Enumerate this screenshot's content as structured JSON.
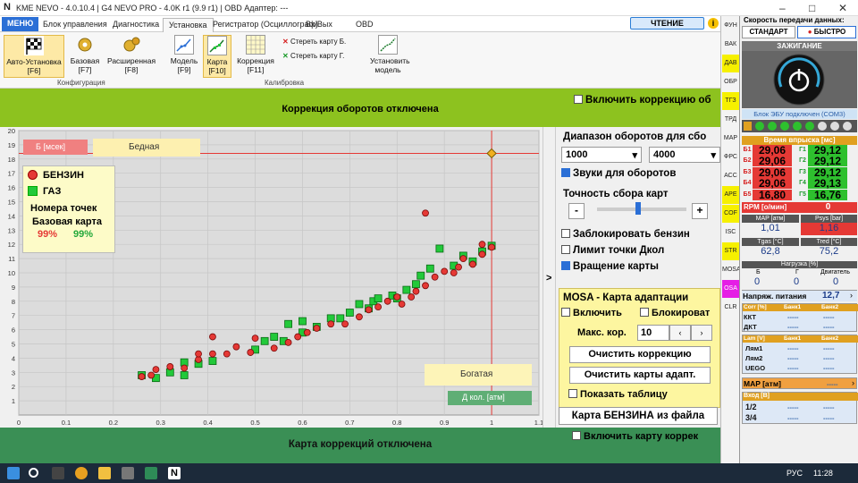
{
  "titlebar": {
    "title": "KME NEVO - 4.0.10.4  |  G4 NEVO PRO - 4.0K r1 (9.9 r1)  |  OBD Адаптер: ---"
  },
  "menu": {
    "items": [
      "МЕНЮ",
      "Блок управления",
      "Диагностика",
      "Установка",
      "Регистратор (Осциллограф)",
      "Вх/Вых",
      "OBD"
    ],
    "read_button": "ЧТЕНИЕ"
  },
  "ribbon": {
    "auto": "Авто-Установка [F6]",
    "base": "Базовая [F7]",
    "ext": "Расширенная [F8]",
    "model": "Модель [F9]",
    "map": "Карта [F10]",
    "corr": "Коррекция [F11]",
    "erase_b": "Стереть карту Б.",
    "erase_g": "Стереть карту Г.",
    "set_model": "Установить модель",
    "group_config": "Конфигурация",
    "group_calib": "Калибровка"
  },
  "banner_top": {
    "text": "Коррекция оборотов отключена",
    "checkbox": "Включить коррекцию об"
  },
  "banner_bottom": {
    "text": "Карта коррекций отключена",
    "checkbox": "Включить карту коррек"
  },
  "chart_labels": {
    "b_label": "Б [мсек]",
    "poor": "Бедная",
    "rich": "Богатая",
    "d_label": "Д кол. [атм]"
  },
  "legend": {
    "petrol": "БЕНЗИН",
    "gas": "ГАЗ",
    "points_title": "Номера точек",
    "base_title": "Базовая карта",
    "petrol_pct": "99%",
    "gas_pct": "99%"
  },
  "right_panel": {
    "rpm_range": "Диапазон оборотов для сбо",
    "rpm_from": "1000",
    "rpm_to": "4000",
    "sounds": "Звуки для оборотов",
    "precision": "Точность сбора карт",
    "minus": "-",
    "plus": "+",
    "block_petrol": "Заблокировать бензин",
    "limit": "Лимит точки Дкол",
    "rotate": "Вращение карты",
    "mosa_title": "MOSA - Карта адаптации",
    "enable": "Включить",
    "block": "Блокироват",
    "max_corr_label": "Макс. кор.",
    "max_corr": "10",
    "clear_corr": "Очистить коррекцию",
    "clear_maps": "Очистить карты адапт.",
    "show_table": "Показать таблицу",
    "load_map": "Карта БЕНЗИНА из файла"
  },
  "sidenav": [
    "ФУН",
    "ВАК",
    "ДАВ",
    "ОБР",
    "ТГЗ",
    "ТРД",
    "МАР",
    "ФРС",
    "АСС",
    "АРЕ",
    "COF",
    "ISC",
    "STR",
    "MOSA",
    "OSA",
    "CLR"
  ],
  "dash": {
    "speed_title": "Скорость передачи данных:",
    "std": "СТАНДАРТ",
    "fast": "БЫСТРО",
    "ignition": "ЗАЖИГАНИЕ",
    "ecu": "Блок ЭБУ подключен (COM3)",
    "inj_title": "Время впрыска [мс]",
    "b_labels": [
      "Б1",
      "Б2",
      "Б3",
      "Б4",
      "Б5"
    ],
    "b_vals": [
      "29,06",
      "29,06",
      "29,06",
      "29,06",
      "16,80"
    ],
    "g_labels": [
      "Г1",
      "Г2",
      "Г3",
      "Г4",
      "Г5"
    ],
    "g_vals": [
      "29,12",
      "29,12",
      "29,12",
      "29,13",
      "16,76"
    ],
    "rpm_label": "RPM [о/мин]",
    "rpm": "0",
    "map_label": "MAP [атм]",
    "map": "1,01",
    "psys_label": "Psys [bar]",
    "psys": "1,16",
    "tgas_label": "Tgas [°C]",
    "tgas": "62,8",
    "tred_label": "Tred [°C]",
    "tred": "75,2",
    "load_label": "Нагрузка [%]",
    "b": "Б",
    "g": "Г",
    "engine": "Двигатель",
    "b_load": "0",
    "g_load": "0",
    "e_load": "0",
    "voltage_label": "Напряж. питания",
    "voltage": "12,7",
    "corr_label": "Corr [%]",
    "bank1": "Банк1",
    "bank2": "Банк2",
    "kkt": "ККТ",
    "dkt": "ДКТ",
    "lam_label": "Lam [V]",
    "lam1": "Лям1",
    "lam2": "Лям2",
    "uego": "UEGO",
    "map2_label": "MAP  [атм]",
    "in_label": "Вход [В]",
    "in1": "1/2",
    "in2": "3/4",
    "dash": "-----"
  },
  "taskbar": {
    "lang": "РУС",
    "time": "11:28"
  },
  "chart_data": {
    "type": "scatter",
    "xlabel": "Д кол. [атм]",
    "ylabel": "Б [мсек]",
    "xlim": [
      0,
      1.1
    ],
    "ylim": [
      0,
      20
    ],
    "x_ticks": [
      0,
      0.1,
      0.2,
      0.3,
      0.4,
      0.5,
      0.6,
      0.7,
      0.8,
      0.9,
      1,
      1.1
    ],
    "y_ticks": [
      1,
      2,
      3,
      4,
      5,
      6,
      7,
      8,
      9,
      10,
      11,
      12,
      13,
      14,
      15,
      16,
      17,
      18,
      19,
      20
    ],
    "series": [
      {
        "name": "БЕНЗИН",
        "color": "#e53935",
        "points": [
          [
            0.26,
            2.7
          ],
          [
            0.28,
            2.8
          ],
          [
            0.29,
            3.2
          ],
          [
            0.32,
            3.4
          ],
          [
            0.35,
            3.3
          ],
          [
            0.38,
            3.9
          ],
          [
            0.38,
            4.3
          ],
          [
            0.41,
            4.3
          ],
          [
            0.41,
            5.5
          ],
          [
            0.44,
            4.3
          ],
          [
            0.46,
            4.8
          ],
          [
            0.49,
            4.4
          ],
          [
            0.5,
            5.4
          ],
          [
            0.54,
            4.7
          ],
          [
            0.57,
            5.1
          ],
          [
            0.59,
            5.5
          ],
          [
            0.61,
            5.8
          ],
          [
            0.63,
            6.1
          ],
          [
            0.66,
            6.4
          ],
          [
            0.69,
            6.4
          ],
          [
            0.72,
            6.9
          ],
          [
            0.74,
            7.4
          ],
          [
            0.76,
            7.6
          ],
          [
            0.78,
            8.0
          ],
          [
            0.8,
            8.3
          ],
          [
            0.81,
            7.8
          ],
          [
            0.83,
            8.3
          ],
          [
            0.84,
            8.7
          ],
          [
            0.86,
            9.1
          ],
          [
            0.86,
            14.2
          ],
          [
            0.88,
            9.7
          ],
          [
            0.9,
            10.1
          ],
          [
            0.92,
            10.0
          ],
          [
            0.93,
            10.4
          ],
          [
            0.94,
            11.0
          ],
          [
            0.96,
            10.6
          ],
          [
            0.98,
            11.3
          ],
          [
            0.98,
            12.0
          ],
          [
            1.0,
            11.8
          ]
        ]
      },
      {
        "name": "ГАЗ",
        "color": "#22c93a",
        "points": [
          [
            0.26,
            2.8
          ],
          [
            0.29,
            2.6
          ],
          [
            0.32,
            3.0
          ],
          [
            0.35,
            2.8
          ],
          [
            0.35,
            3.7
          ],
          [
            0.38,
            3.6
          ],
          [
            0.41,
            3.8
          ],
          [
            0.5,
            4.6
          ],
          [
            0.52,
            5.2
          ],
          [
            0.54,
            5.5
          ],
          [
            0.56,
            5.2
          ],
          [
            0.57,
            6.4
          ],
          [
            0.6,
            5.8
          ],
          [
            0.6,
            6.6
          ],
          [
            0.63,
            6.2
          ],
          [
            0.66,
            6.8
          ],
          [
            0.68,
            6.8
          ],
          [
            0.7,
            7.2
          ],
          [
            0.72,
            7.8
          ],
          [
            0.74,
            7.5
          ],
          [
            0.75,
            8.0
          ],
          [
            0.76,
            8.2
          ],
          [
            0.79,
            8.4
          ],
          [
            0.8,
            8.2
          ],
          [
            0.82,
            8.8
          ],
          [
            0.84,
            9.2
          ],
          [
            0.85,
            9.8
          ],
          [
            0.87,
            10.3
          ],
          [
            0.89,
            11.7
          ],
          [
            0.92,
            10.5
          ],
          [
            0.94,
            11.2
          ],
          [
            0.96,
            10.8
          ],
          [
            0.98,
            11.5
          ],
          [
            1.0,
            11.9
          ]
        ]
      }
    ],
    "crosshair": {
      "x": 1.0,
      "y": 18.4
    }
  }
}
